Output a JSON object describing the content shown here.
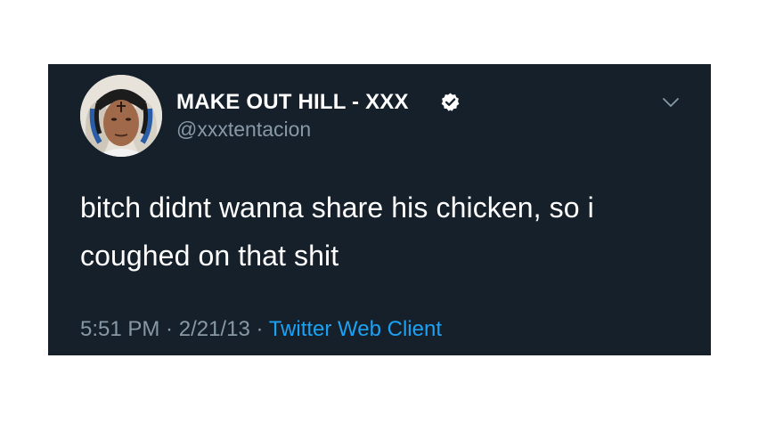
{
  "tweet": {
    "display_name": "MAKE OUT HILL - XXX",
    "handle": "@xxxtentacion",
    "verified": true,
    "text_line1": "bitch didnt wanna share his chicken, so i",
    "text_line2": "coughed on that shit",
    "time": "5:51 PM",
    "separator": " · ",
    "date": "2/21/13",
    "source": "Twitter Web Client"
  },
  "icons": {
    "avatar": "avatar-photo",
    "verified": "verified-badge-icon",
    "menu": "chevron-down-icon"
  },
  "colors": {
    "card_background": "#15202b",
    "primary_text": "#ffffff",
    "secondary_text": "#8899a6",
    "link": "#1da1f2",
    "page_background": "#ffffff"
  }
}
